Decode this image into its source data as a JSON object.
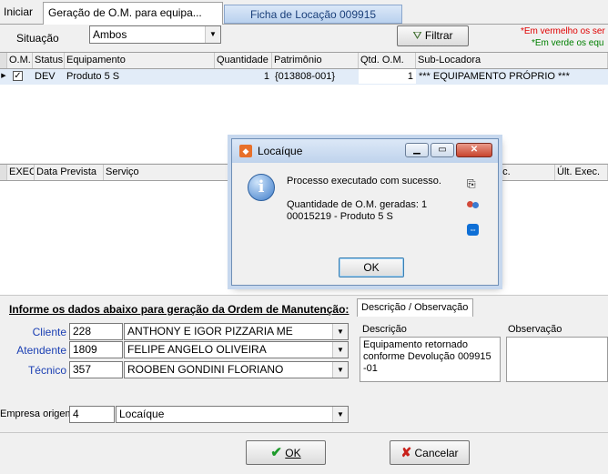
{
  "tabs": [
    {
      "label": "Iniciar"
    },
    {
      "label": "Geração de O.M. para equipa..."
    },
    {
      "label": "Ficha de Locação 009915"
    }
  ],
  "filter": {
    "situacao_label": "Situação",
    "situacao_value": "Ambos",
    "filtrar_label": "Filtrar",
    "legend_red": "*Em vermelho os ser",
    "legend_green": "*Em verde os equ",
    "legend_red_color": "#e00000",
    "legend_green_color": "#008000"
  },
  "grid1": {
    "columns": [
      "O.M.",
      "Status",
      "Equipamento",
      "Quantidade",
      "Patrimônio",
      "Qtd. O.M.",
      "Sub-Locadora"
    ],
    "rows": [
      {
        "checked": true,
        "status": "DEV",
        "equipamento": "Produto 5 S",
        "quantidade": "1",
        "patrimonio": "{013808-001}",
        "qtd_om": "1",
        "sublocadora": "*** EQUIPAMENTO PRÓPRIO ***"
      }
    ]
  },
  "grid2": {
    "columns": [
      "EXEC",
      "Data Prevista",
      "Serviço",
      "ec.",
      "Últ. Exec."
    ]
  },
  "dialog": {
    "title": "Locaíque",
    "message1": "Processo executado com sucesso.",
    "message2": "Quantidade de O.M. geradas: 1",
    "message3": "00015219 - Produto 5 S",
    "ok_label": "OK",
    "info_icon": "info-icon",
    "side_icons": [
      "copy-icon",
      "users-icon",
      "teamviewer-icon"
    ]
  },
  "form": {
    "heading": "Informe os dados abaixo para geração da Ordem de Manutenção:",
    "desc_tab": "Descrição / Observação",
    "cliente_label": "Cliente",
    "cliente_code": "228",
    "cliente_name": "ANTHONY E IGOR PIZZARIA ME",
    "atendente_label": "Atendente",
    "atendente_code": "1809",
    "atendente_name": "FELIPE ANGELO OLIVEIRA",
    "tecnico_label": "Técnico",
    "tecnico_code": "357",
    "tecnico_name": "ROOBEN GONDINI FLORIANO",
    "empresa_label": "Empresa origem",
    "empresa_code": "4",
    "empresa_name": "Locaíque",
    "descricao_label": "Descrição",
    "descricao_text": "Equipamento retornado conforme Devolução 009915 -01",
    "observacao_label": "Observação",
    "observacao_text": ""
  },
  "buttons": {
    "ok_label": "OK",
    "cancel_label": "Cancelar"
  }
}
